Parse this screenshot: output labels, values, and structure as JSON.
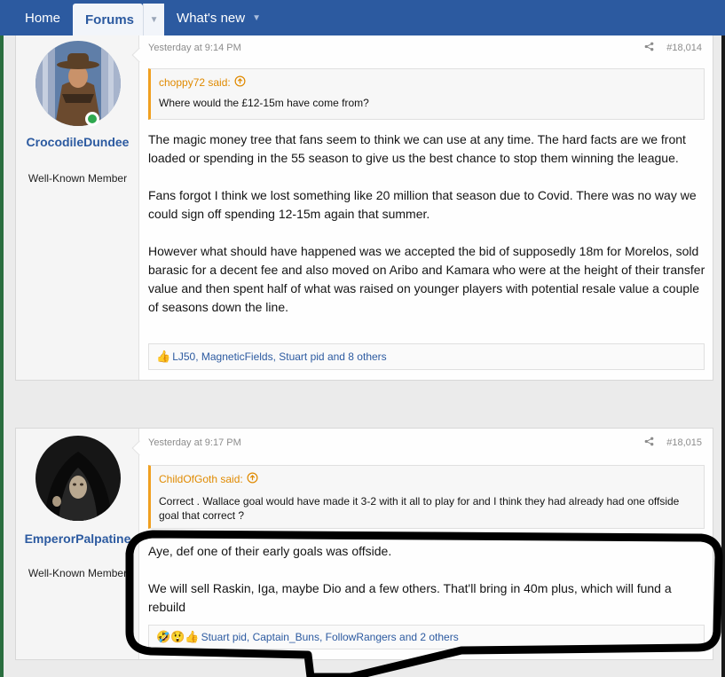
{
  "nav": {
    "home": "Home",
    "forums": "Forums",
    "whats_new": "What's new"
  },
  "posts": [
    {
      "user": {
        "name": "CrocodileDundee",
        "title": "Well-Known Member",
        "online": true
      },
      "time": "Yesterday at 9:14 PM",
      "number": "#18,014",
      "quote": {
        "author": "choppy72 said:",
        "text": "Where would the £12-15m have come from?"
      },
      "paragraphs": [
        "The magic money tree that fans seem to think we can use at any time. The hard facts are we front loaded or spending in the 55 season to give us the best chance to stop them winning the league.",
        "Fans forgot I think we lost something like 20 million that season due to Covid. There was no way we could sign off spending 12-15m again that summer.",
        "However what should have happened was we accepted the bid of supposedly 18m for Morelos, sold barasic for a decent fee and also moved on Aribo and Kamara who were at the height of their transfer value and then spent half of what was raised on younger players with potential resale value a couple of seasons down the line."
      ],
      "reactions": {
        "emoji": "👍",
        "text": "LJ50, MagneticFields, Stuart pid and 8 others"
      }
    },
    {
      "user": {
        "name": "EmperorPalpatine",
        "title": "Well-Known Member",
        "online": false
      },
      "time": "Yesterday at 9:17 PM",
      "number": "#18,015",
      "quote": {
        "author": "ChildOfGoth said:",
        "text": "Correct . Wallace goal would have made it 3-2 with it all to play for and I think they had already had one offside goal that correct ?"
      },
      "paragraphs": [
        "Aye, def one of their early goals was offside.",
        "We will sell Raskin, Iga, maybe Dio and a few others. That'll bring in 40m plus, which will fund a rebuild"
      ],
      "reactions": {
        "emoji": "🤣😲👍",
        "text": "Stuart pid, Captain_Buns, FollowRangers and 2 others"
      }
    }
  ],
  "colors": {
    "nav_bg": "#2c5aa0",
    "link": "#2c5aa0",
    "quote_accent": "#f0a020",
    "online": "#2fa84f"
  }
}
